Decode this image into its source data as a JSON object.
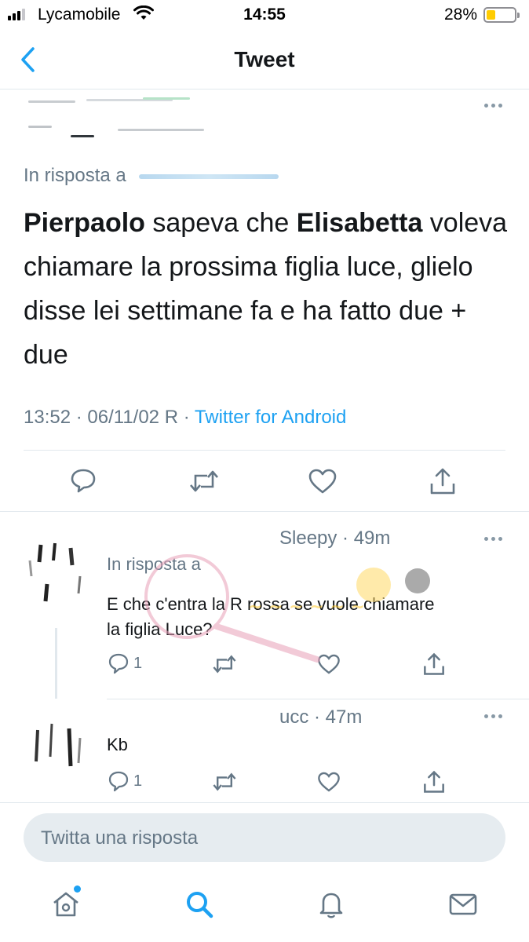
{
  "status_bar": {
    "carrier": "Lycamobile",
    "time": "14:55",
    "battery_percent": "28%",
    "battery_level": 0.28,
    "signal_bars": 3
  },
  "nav": {
    "title": "Tweet",
    "back_icon": "chevron-left-icon"
  },
  "tweet": {
    "in_reply_prefix": "In risposta a",
    "text_part1": "Pierpaolo",
    "text_part2": " sapeva che ",
    "text_part3": "Elisabetta",
    "text_part4": " voleva chiamare la prossima figlia luce, glielo disse lei settimane fa e ha fatto due + due",
    "timestamp": "13:52 · 06/11/02 R · ",
    "source": "Twitter for Android",
    "actions": [
      "reply-icon",
      "retweet-icon",
      "like-icon",
      "share-icon"
    ]
  },
  "replies": [
    {
      "meta": "Sleepy · 49m",
      "in_reply_prefix": "In risposta a",
      "text": "E che c'entra la R rossa se vuole chiamare la figlia Luce?",
      "reply_count": "1"
    },
    {
      "meta": "ucc · 47m",
      "text": "Kb",
      "reply_count": "1"
    }
  ],
  "compose": {
    "placeholder": "Twitta una risposta"
  },
  "tabs": [
    "home-icon",
    "search-icon",
    "notifications-icon",
    "messages-icon"
  ],
  "colors": {
    "accent": "#1da1f2",
    "text": "#14171a",
    "secondary": "#657786"
  }
}
